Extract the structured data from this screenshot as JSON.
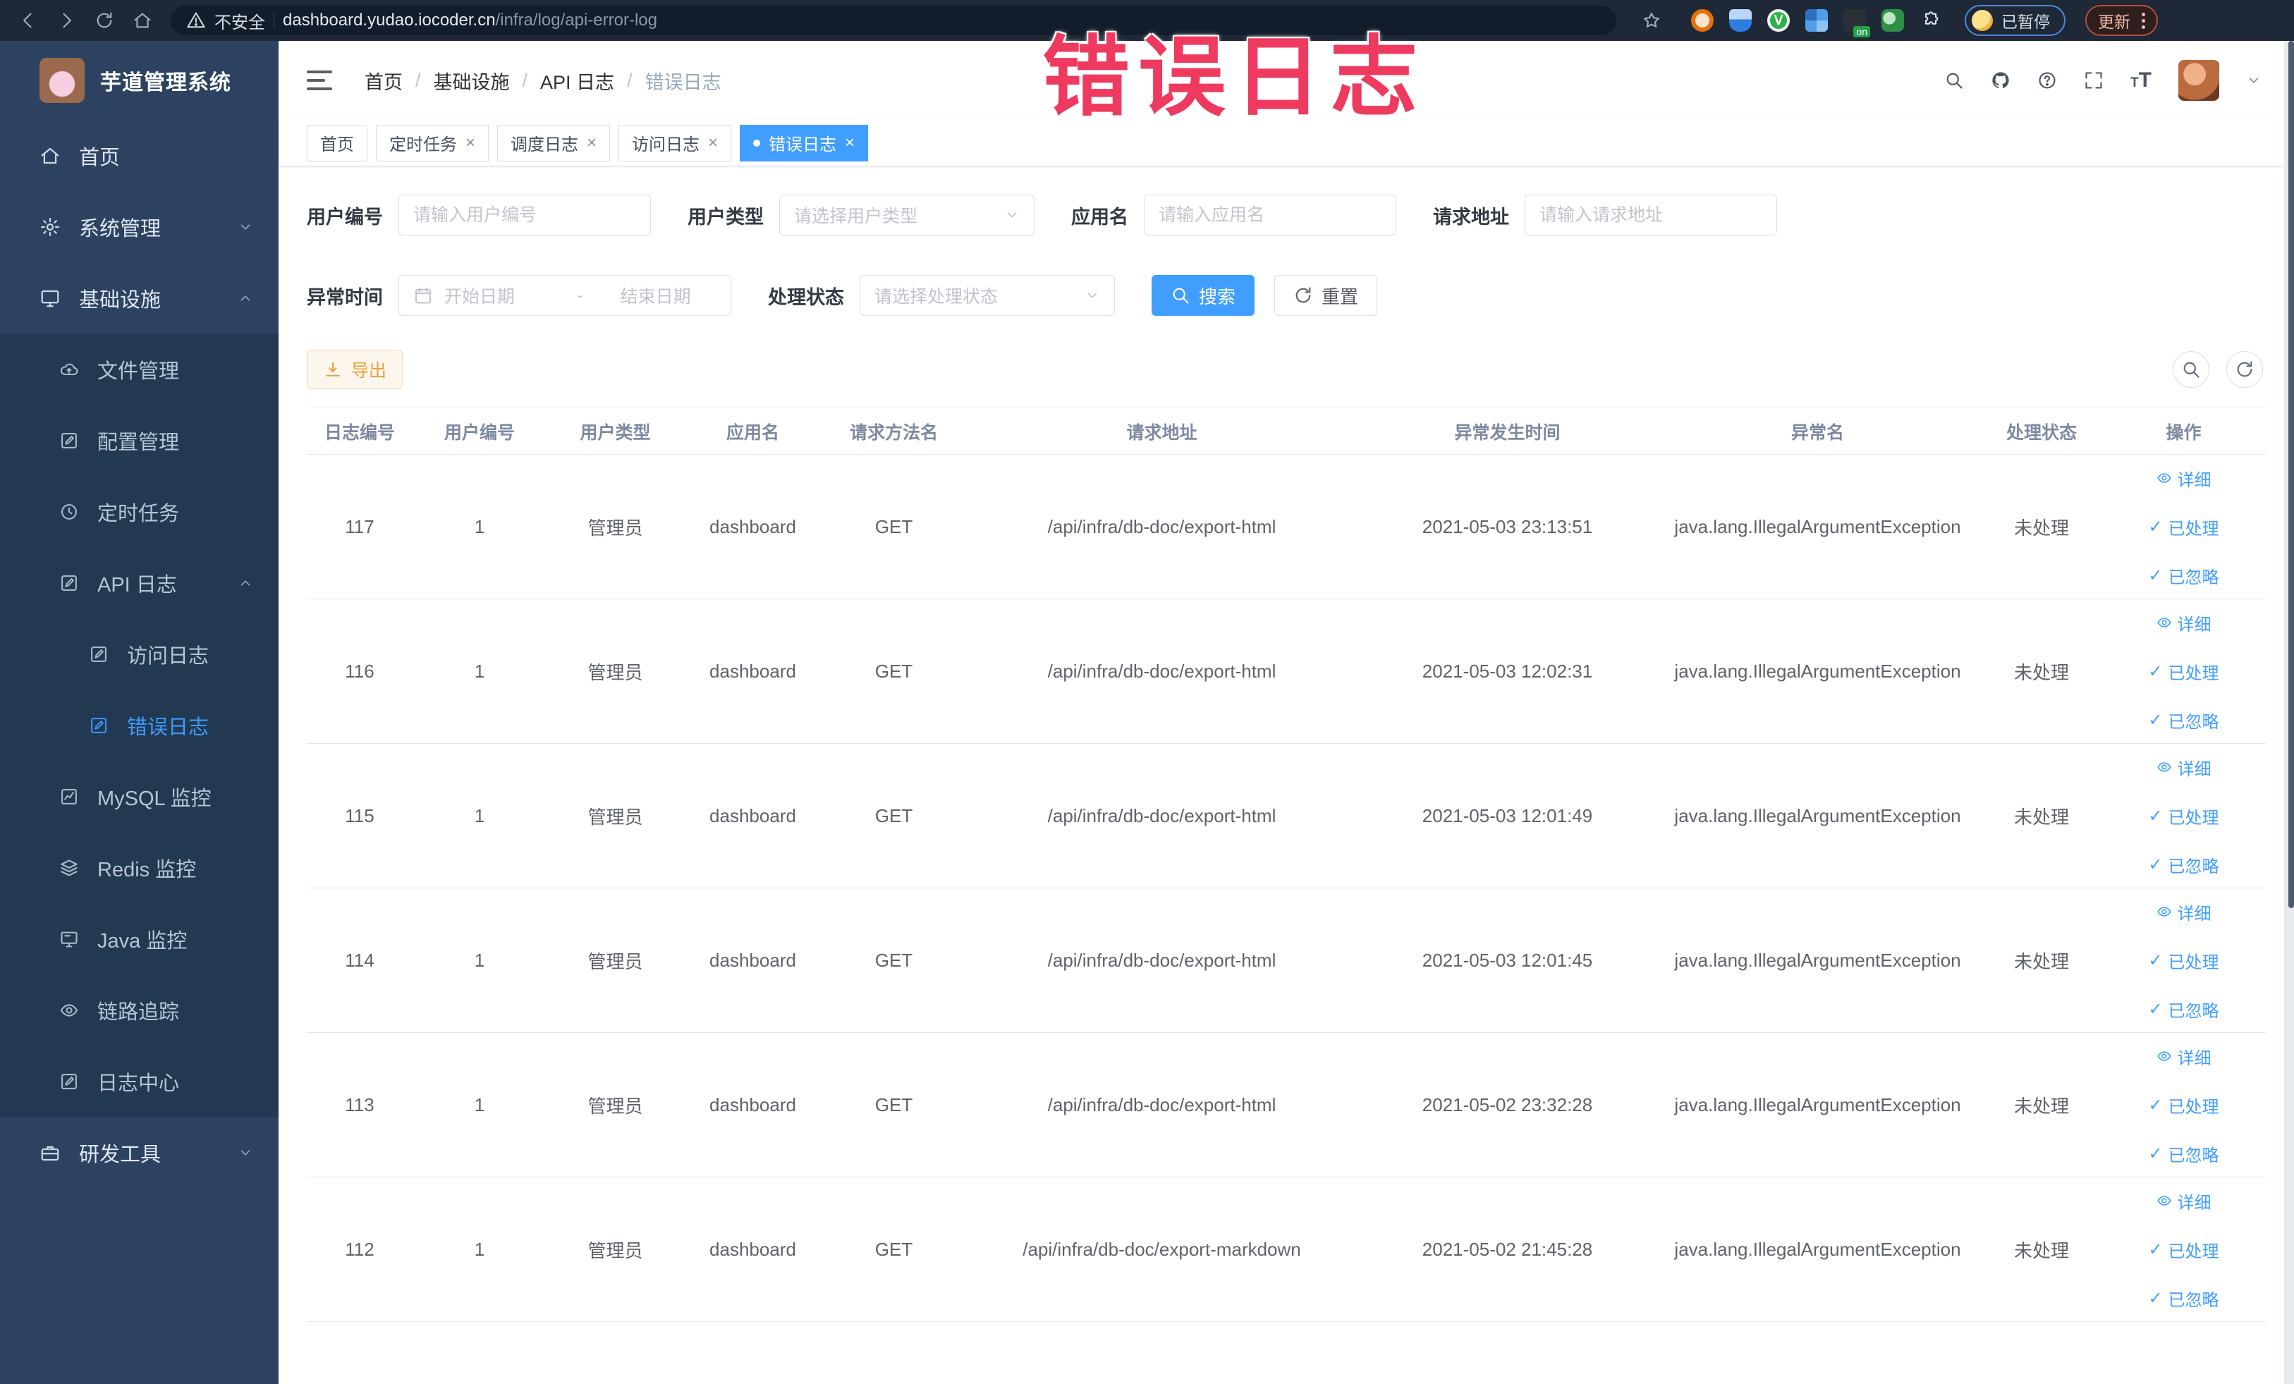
{
  "browser": {
    "security_label": "不安全",
    "url_host": "dashboard.yudao.iocoder.cn",
    "url_path": "/infra/log/api-error-log",
    "paused_label": "已暂停",
    "update_label": "更新"
  },
  "watermark": "错误日志",
  "sidebar": {
    "title": "芋道管理系统",
    "menu": [
      {
        "label": "首页",
        "icon": "home",
        "type": "top"
      },
      {
        "label": "系统管理",
        "icon": "gear",
        "type": "top",
        "arrow": "down"
      },
      {
        "label": "基础设施",
        "icon": "monitor",
        "type": "top",
        "arrow": "up"
      },
      {
        "label": "文件管理",
        "icon": "cloud",
        "type": "sub1"
      },
      {
        "label": "配置管理",
        "icon": "edit",
        "type": "sub1"
      },
      {
        "label": "定时任务",
        "icon": "clock",
        "type": "sub1"
      },
      {
        "label": "API 日志",
        "icon": "edit",
        "type": "sub1",
        "arrow": "up"
      },
      {
        "label": "访问日志",
        "icon": "edit",
        "type": "sub2"
      },
      {
        "label": "错误日志",
        "icon": "edit",
        "type": "sub2",
        "active": true
      },
      {
        "label": "MySQL 监控",
        "icon": "chart",
        "type": "sub1"
      },
      {
        "label": "Redis 监控",
        "icon": "layers",
        "type": "sub1"
      },
      {
        "label": "Java 监控",
        "icon": "screen",
        "type": "sub1"
      },
      {
        "label": "链路追踪",
        "icon": "eye",
        "type": "sub1"
      },
      {
        "label": "日志中心",
        "icon": "edit",
        "type": "sub1"
      },
      {
        "label": "研发工具",
        "icon": "case",
        "type": "top",
        "arrow": "down"
      }
    ]
  },
  "header": {
    "breadcrumb": [
      "首页",
      "基础设施",
      "API 日志",
      "错误日志"
    ]
  },
  "tabs": [
    {
      "label": "首页",
      "closable": false,
      "active": false
    },
    {
      "label": "定时任务",
      "closable": true,
      "active": false
    },
    {
      "label": "调度日志",
      "closable": true,
      "active": false
    },
    {
      "label": "访问日志",
      "closable": true,
      "active": false
    },
    {
      "label": "错误日志",
      "closable": true,
      "active": true
    }
  ],
  "filters": {
    "row1": [
      {
        "label": "用户编号",
        "placeholder": "请输入用户编号",
        "type": "input"
      },
      {
        "label": "用户类型",
        "placeholder": "请选择用户类型",
        "type": "select"
      },
      {
        "label": "应用名",
        "placeholder": "请输入应用名",
        "type": "input"
      },
      {
        "label": "请求地址",
        "placeholder": "请输入请求地址",
        "type": "input"
      }
    ],
    "row2_label_time": "异常时间",
    "date_start_placeholder": "开始日期",
    "date_separator": "-",
    "date_end_placeholder": "结束日期",
    "row2_label_status": "处理状态",
    "status_placeholder": "请选择处理状态",
    "search_label": "搜索",
    "reset_label": "重置"
  },
  "toolbar": {
    "export_label": "导出"
  },
  "table": {
    "columns": [
      "日志编号",
      "用户编号",
      "用户类型",
      "应用名",
      "请求方法名",
      "请求地址",
      "异常发生时间",
      "异常名",
      "处理状态",
      "操作"
    ],
    "actions": [
      "详细",
      "已处理",
      "已忽略"
    ],
    "rows": [
      {
        "id": "117",
        "user_id": "1",
        "user_type": "管理员",
        "app": "dashboard",
        "method": "GET",
        "url": "/api/infra/db-doc/export-html",
        "time": "2021-05-03 23:13:51",
        "exception": "java.lang.IllegalArgumentException",
        "status": "未处理"
      },
      {
        "id": "116",
        "user_id": "1",
        "user_type": "管理员",
        "app": "dashboard",
        "method": "GET",
        "url": "/api/infra/db-doc/export-html",
        "time": "2021-05-03 12:02:31",
        "exception": "java.lang.IllegalArgumentException",
        "status": "未处理"
      },
      {
        "id": "115",
        "user_id": "1",
        "user_type": "管理员",
        "app": "dashboard",
        "method": "GET",
        "url": "/api/infra/db-doc/export-html",
        "time": "2021-05-03 12:01:49",
        "exception": "java.lang.IllegalArgumentException",
        "status": "未处理"
      },
      {
        "id": "114",
        "user_id": "1",
        "user_type": "管理员",
        "app": "dashboard",
        "method": "GET",
        "url": "/api/infra/db-doc/export-html",
        "time": "2021-05-03 12:01:45",
        "exception": "java.lang.IllegalArgumentException",
        "status": "未处理"
      },
      {
        "id": "113",
        "user_id": "1",
        "user_type": "管理员",
        "app": "dashboard",
        "method": "GET",
        "url": "/api/infra/db-doc/export-html",
        "time": "2021-05-02 23:32:28",
        "exception": "java.lang.IllegalArgumentException",
        "status": "未处理"
      },
      {
        "id": "112",
        "user_id": "1",
        "user_type": "管理员",
        "app": "dashboard",
        "method": "GET",
        "url": "/api/infra/db-doc/export-markdown",
        "time": "2021-05-02 21:45:28",
        "exception": "java.lang.IllegalArgumentException",
        "status": "未处理"
      }
    ]
  },
  "colors": {
    "accent": "#409eff",
    "warning": "#e6a23c",
    "watermark_pink": "#ee3a5f",
    "sidebar_bg": "#2c4260",
    "sidebar_submenu_bg": "#233952"
  }
}
